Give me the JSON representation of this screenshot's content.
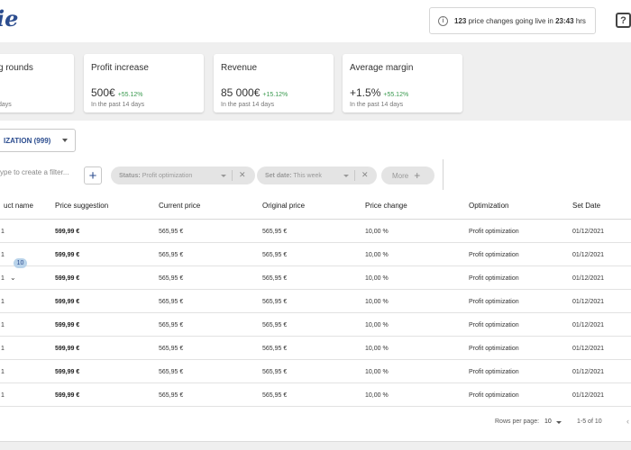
{
  "header": {
    "logo_text": "ie",
    "notice": {
      "count": "123",
      "text": "price changes going live in",
      "time": "23:43",
      "unit": "hrs"
    },
    "help_icon": "?"
  },
  "kpis": [
    {
      "title": "g rounds",
      "value": "",
      "delta": "",
      "sub": "days"
    },
    {
      "title": "Profit increase",
      "value": "500€",
      "delta": "+55.12%",
      "sub": "In the past 14 days"
    },
    {
      "title": "Revenue",
      "value": "85 000€",
      "delta": "+15.12%",
      "sub": "In the past 14 days"
    },
    {
      "title": "Average margin",
      "value": "+1.5%",
      "delta": "+55.12%",
      "sub": "In the past 14 days"
    }
  ],
  "optimization_select": {
    "value": "IZATION (999)"
  },
  "filters": {
    "placeholder": "ype to create a filter...",
    "add_label": "+",
    "chips": [
      {
        "key": "Status:",
        "value": "Profit optimization"
      },
      {
        "key": "Set date:",
        "value": "This week"
      }
    ],
    "more_label": "More"
  },
  "table": {
    "columns": [
      "uct name",
      "Price suggestion",
      "Current price",
      "Original price",
      "Price change",
      "Optimization",
      "Set Date"
    ],
    "badge": "10",
    "rows": [
      {
        "name": "1",
        "suggestion": "599,99 €",
        "current": "565,95 €",
        "original": "565,95 €",
        "change": "10,00 %",
        "optimization": "Profit optimization",
        "date": "01/12/2021"
      },
      {
        "name": "1",
        "suggestion": "599,99 €",
        "current": "565,95 €",
        "original": "565,95 €",
        "change": "10,00 %",
        "optimization": "Profit optimization",
        "date": "01/12/2021"
      },
      {
        "name": "1",
        "suggestion": "599,99 €",
        "current": "565,95 €",
        "original": "565,95 €",
        "change": "10,00 %",
        "optimization": "Profit optimization",
        "date": "01/12/2021"
      },
      {
        "name": "1",
        "suggestion": "599,99 €",
        "current": "565,95 €",
        "original": "565,95 €",
        "change": "10,00 %",
        "optimization": "Profit optimization",
        "date": "01/12/2021"
      },
      {
        "name": "1",
        "suggestion": "599,99 €",
        "current": "565,95 €",
        "original": "565,95 €",
        "change": "10,00 %",
        "optimization": "Profit optimization",
        "date": "01/12/2021"
      },
      {
        "name": "1",
        "suggestion": "599,99 €",
        "current": "565,95 €",
        "original": "565,95 €",
        "change": "10,00 %",
        "optimization": "Profit optimization",
        "date": "01/12/2021"
      },
      {
        "name": "1",
        "suggestion": "599,99 €",
        "current": "565,95 €",
        "original": "565,95 €",
        "change": "10,00 %",
        "optimization": "Profit optimization",
        "date": "01/12/2021"
      },
      {
        "name": "1",
        "suggestion": "599,99 €",
        "current": "565,95 €",
        "original": "565,95 €",
        "change": "10,00 %",
        "optimization": "Profit optimization",
        "date": "01/12/2021"
      }
    ]
  },
  "pagination": {
    "rows_label": "Rows per page:",
    "rows_value": "10",
    "range": "1-5 of 10"
  },
  "colors": {
    "brand": "#2c4d8f",
    "positive": "#3a9a4f",
    "panel_bg": "#efefef"
  },
  "icons": [
    "info-icon",
    "help-icon",
    "caret-down-icon",
    "plus-icon",
    "close-icon",
    "chevron-down-icon",
    "chevron-left-icon"
  ]
}
